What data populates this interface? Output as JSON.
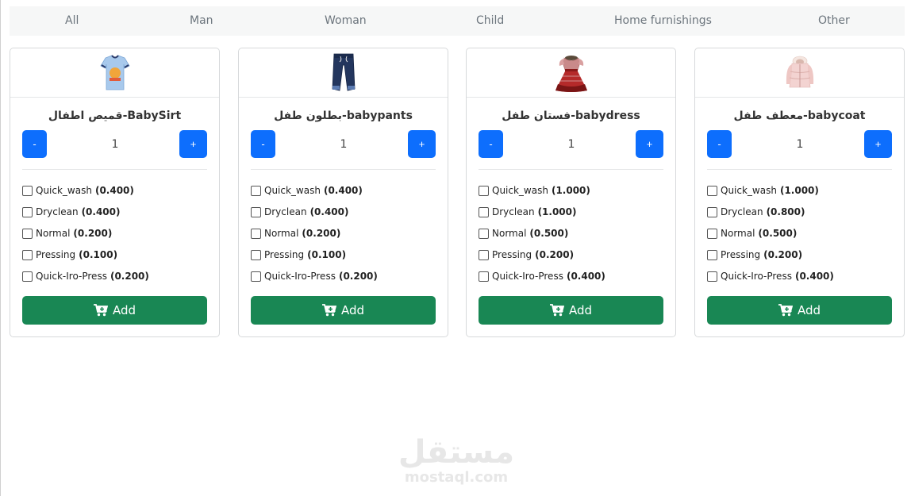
{
  "tabs": [
    "All",
    "Man",
    "Woman",
    "Child",
    "Home furnishings",
    "Other"
  ],
  "products": [
    {
      "name": "قميص اطفال-BabySirt",
      "image_icon": "tshirt-icon",
      "quantity": "1",
      "services": [
        {
          "label": "Quick_wash",
          "price": "(0.400)"
        },
        {
          "label": "Dryclean",
          "price": "(0.400)"
        },
        {
          "label": "Normal",
          "price": "(0.200)"
        },
        {
          "label": "Pressing",
          "price": "(0.100)"
        },
        {
          "label": "Quick-Iro-Press",
          "price": "(0.200)"
        }
      ]
    },
    {
      "name": "بطلون طفل-babypants",
      "image_icon": "jeans-icon",
      "quantity": "1",
      "services": [
        {
          "label": "Quick_wash",
          "price": "(0.400)"
        },
        {
          "label": "Dryclean",
          "price": "(0.400)"
        },
        {
          "label": "Normal",
          "price": "(0.200)"
        },
        {
          "label": "Pressing",
          "price": "(0.100)"
        },
        {
          "label": "Quick-Iro-Press",
          "price": "(0.200)"
        }
      ]
    },
    {
      "name": "فستان طفل-babydress",
      "image_icon": "dress-icon",
      "quantity": "1",
      "services": [
        {
          "label": "Quick_wash",
          "price": "(1.000)"
        },
        {
          "label": "Dryclean",
          "price": "(1.000)"
        },
        {
          "label": "Normal",
          "price": "(0.500)"
        },
        {
          "label": "Pressing",
          "price": "(0.200)"
        },
        {
          "label": "Quick-Iro-Press",
          "price": "(0.400)"
        }
      ]
    },
    {
      "name": "معطف طفل-babycoat",
      "image_icon": "coat-icon",
      "quantity": "1",
      "services": [
        {
          "label": "Quick_wash",
          "price": "(1.000)"
        },
        {
          "label": "Dryclean",
          "price": "(0.800)"
        },
        {
          "label": "Normal",
          "price": "(0.500)"
        },
        {
          "label": "Pressing",
          "price": "(0.200)"
        },
        {
          "label": "Quick-Iro-Press",
          "price": "(0.400)"
        }
      ]
    }
  ],
  "buttons": {
    "minus": "-",
    "plus": "+",
    "add": "Add",
    "add_icon": "cart-plus-icon"
  },
  "watermark": {
    "arabic": "مستقل",
    "latin": "mostaql.com"
  },
  "colors": {
    "primary": "#0d6efd",
    "success": "#198754",
    "tab_bar": "#f6f7f7"
  }
}
